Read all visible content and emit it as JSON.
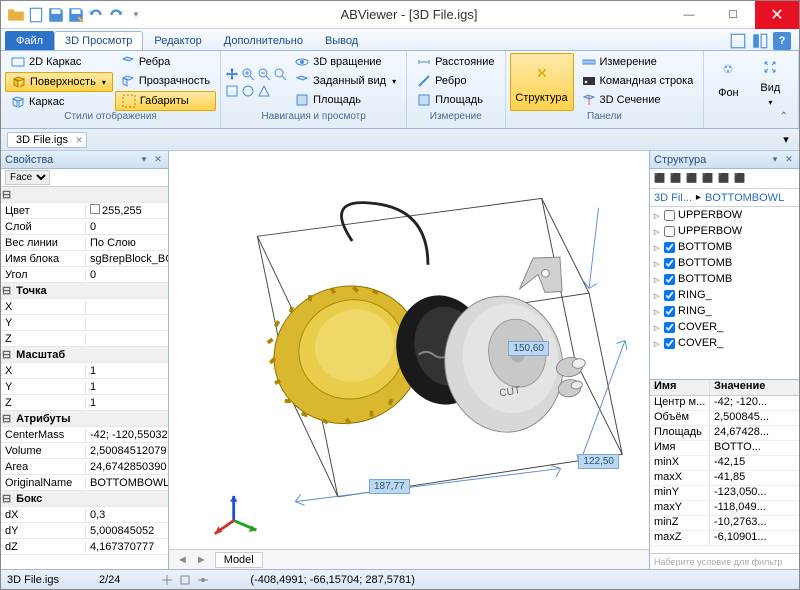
{
  "title": "ABViewer - [3D File.igs]",
  "qat_icons": [
    "file-open",
    "new",
    "save",
    "save-as",
    "undo",
    "redo"
  ],
  "tabs": {
    "file": "Файл",
    "items": [
      "3D Просмотр",
      "Редактор",
      "Дополнительно",
      "Вывод"
    ],
    "active": 0
  },
  "ribbon": {
    "styles": {
      "label": "Стили отображения",
      "btns": [
        {
          "label": "2D Каркас",
          "sel": false
        },
        {
          "label": "Ребра",
          "sel": false
        },
        {
          "label": "Поверхность",
          "sel": true
        },
        {
          "label": "Прозрачность",
          "sel": false
        },
        {
          "label": "Каркас",
          "sel": false
        },
        {
          "label": "Габариты",
          "sel": true
        }
      ]
    },
    "nav": {
      "label": "Навигация и просмотр",
      "btns": [
        "3D вращение",
        "Заданный вид",
        "Площадь"
      ]
    },
    "measure": {
      "label": "Измерение",
      "btns": [
        "Расстояние",
        "Ребро",
        "Площадь"
      ]
    },
    "structure": {
      "label": "Структура",
      "group": "Панели",
      "panel_btns": [
        "Измерение",
        "Командная строка",
        "3D Сечение"
      ]
    },
    "view": {
      "bg": "Фон",
      "view": "Вид"
    }
  },
  "filetab": "3D File.igs",
  "props": {
    "title": "Свойства",
    "selector": "Face",
    "rows": [
      {
        "cat": true,
        "k": ""
      },
      {
        "k": "Цвет",
        "v": "255,255",
        "color": true
      },
      {
        "k": "Слой",
        "v": "0"
      },
      {
        "k": "Вес линии",
        "v": "По Слою"
      },
      {
        "k": "Имя блока",
        "v": "sgBrepBlock_BO"
      },
      {
        "k": "Угол",
        "v": "0"
      },
      {
        "cat": true,
        "k": "Точка"
      },
      {
        "k": "X",
        "v": ""
      },
      {
        "k": "Y",
        "v": ""
      },
      {
        "k": "Z",
        "v": ""
      },
      {
        "cat": true,
        "k": "Масштаб"
      },
      {
        "k": "X",
        "v": "1"
      },
      {
        "k": "Y",
        "v": "1"
      },
      {
        "k": "Z",
        "v": "1"
      },
      {
        "cat": true,
        "k": "Атрибуты"
      },
      {
        "k": "CenterMass",
        "v": "-42; -120,55032"
      },
      {
        "k": "Volume",
        "v": "2,50084512079"
      },
      {
        "k": "Area",
        "v": "24,6742850390"
      },
      {
        "k": "OriginalName",
        "v": "BOTTOMBOWL"
      },
      {
        "cat": true,
        "k": "Бокс"
      },
      {
        "k": "dX",
        "v": "0,3"
      },
      {
        "k": "dY",
        "v": "5,000845052"
      },
      {
        "k": "dZ",
        "v": "4,167370777"
      }
    ]
  },
  "dims": {
    "a": "150,60",
    "b": "187,77",
    "c": "122,50"
  },
  "model_tab": "Model",
  "structure": {
    "title": "Структура",
    "crumb": [
      "3D Fil...",
      "BOTTOMBOWL"
    ],
    "items": [
      {
        "label": "UPPERBOW",
        "chk": false
      },
      {
        "label": "UPPERBOW",
        "chk": false
      },
      {
        "label": "BOTTOMB",
        "chk": true
      },
      {
        "label": "BOTTOMB",
        "chk": true
      },
      {
        "label": "BOTTOMB",
        "chk": true
      },
      {
        "label": "RING_",
        "chk": true
      },
      {
        "label": "RING_",
        "chk": true
      },
      {
        "label": "COVER_",
        "chk": true
      },
      {
        "label": "COVER_",
        "chk": true
      }
    ]
  },
  "info": {
    "hdr": {
      "k": "Имя",
      "v": "Значение"
    },
    "rows": [
      {
        "k": "Центр м...",
        "v": "-42; -120..."
      },
      {
        "k": "Объём",
        "v": "2,500845..."
      },
      {
        "k": "Площадь",
        "v": "24,67428..."
      },
      {
        "k": "Имя",
        "v": "BOTTO..."
      },
      {
        "k": "minX",
        "v": "-42,15"
      },
      {
        "k": "maxX",
        "v": "-41,85"
      },
      {
        "k": "minY",
        "v": "-123,050..."
      },
      {
        "k": "maxY",
        "v": "-118,049..."
      },
      {
        "k": "minZ",
        "v": "-10,2763..."
      },
      {
        "k": "maxZ",
        "v": "-6,10901..."
      }
    ],
    "filter": "Наберите условие для фильтр"
  },
  "status": {
    "file": "3D File.igs",
    "prog": "2/24",
    "coords": "(-408,4991; -66,15704; 287,5781)"
  }
}
